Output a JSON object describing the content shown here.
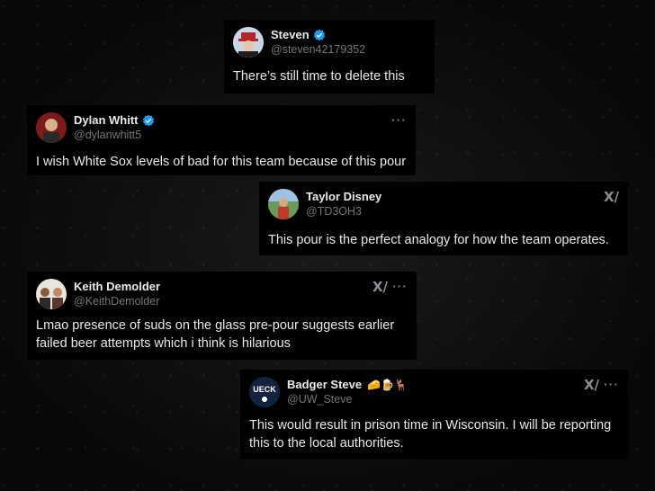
{
  "tweets": [
    {
      "name": "Steven",
      "handle": "@steven42179352",
      "verified": true,
      "text": "There’s still time to delete this"
    },
    {
      "name": "Dylan Whitt",
      "handle": "@dylanwhitt5",
      "verified": true,
      "text": "I wish White Sox levels of bad for this team because of this pour"
    },
    {
      "name": "Taylor Disney",
      "handle": "@TD3OH3",
      "verified": false,
      "text": "This pour is the perfect analogy for how the team operates."
    },
    {
      "name": "Keith Demolder",
      "handle": "@KeithDemolder",
      "verified": false,
      "text_line1": "Lmao presence of suds on the glass pre-pour suggests earlier",
      "text_line2": "failed beer attempts which i think is hilarious"
    },
    {
      "name": "Badger Steve",
      "handle": "@UW_Steve",
      "verified": false,
      "emojis": "🧀🍺🦌",
      "avatar_text": "UECK",
      "text_line1": "This would result in prison time in Wisconsin. I will be reporting",
      "text_line2": "this to the local authorities."
    }
  ],
  "icons": {
    "more": "···",
    "grok": "X/"
  },
  "colors": {
    "verified_blue": "#1d9bf0",
    "card_bg": "#000000",
    "handle_gray": "#71767b"
  }
}
